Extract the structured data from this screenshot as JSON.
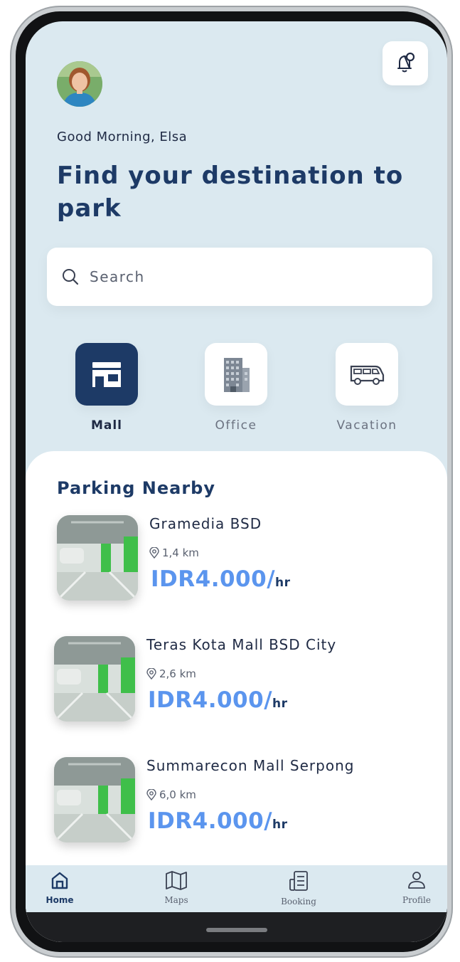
{
  "header": {
    "greeting": "Good Morning, Elsa",
    "headline": "Find your destination to park"
  },
  "search": {
    "placeholder": "Search"
  },
  "categories": [
    {
      "label": "Mall",
      "icon": "store-icon",
      "active": true
    },
    {
      "label": "Office",
      "icon": "office-building-icon",
      "active": false
    },
    {
      "label": "Vacation",
      "icon": "van-icon",
      "active": false
    }
  ],
  "nearby": {
    "title": "Parking Nearby",
    "items": [
      {
        "name": "Gramedia BSD",
        "distance": "1,4 km",
        "price": "IDR4.000/",
        "unit": "hr"
      },
      {
        "name": "Teras Kota Mall BSD City",
        "distance": "2,6 km",
        "price": "IDR4.000/",
        "unit": "hr"
      },
      {
        "name": "Summarecon Mall Serpong",
        "distance": "6,0 km",
        "price": "IDR4.000/",
        "unit": "hr"
      }
    ]
  },
  "tabs": [
    {
      "label": "Home",
      "icon": "home-icon",
      "active": true
    },
    {
      "label": "Maps",
      "icon": "map-icon",
      "active": false
    },
    {
      "label": "Booking",
      "icon": "booking-icon",
      "active": false
    },
    {
      "label": "Profile",
      "icon": "user-icon",
      "active": false
    }
  ],
  "colors": {
    "primary": "#1d3a66",
    "price": "#5b95ee",
    "background": "#dbe9f0"
  }
}
